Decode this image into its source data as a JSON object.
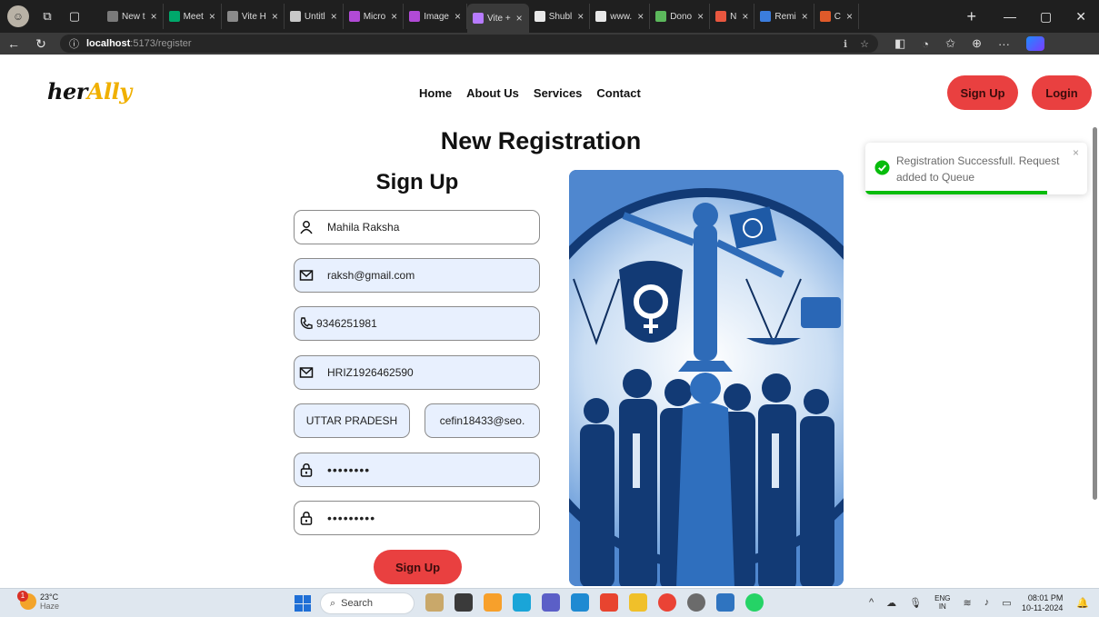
{
  "browser": {
    "tabs": [
      {
        "label": "New t",
        "color": "#7a7a7a"
      },
      {
        "label": "Meet",
        "color": "#00a86b"
      },
      {
        "label": "Vite H",
        "color": "#8a8a8a"
      },
      {
        "label": "Untitl",
        "color": "#c8c8c8"
      },
      {
        "label": "Micro",
        "color": "#b14ad6"
      },
      {
        "label": "Image",
        "color": "#b14ad6"
      },
      {
        "label": "Vite +",
        "color": "#b77bff",
        "active": true
      },
      {
        "label": "Shubl",
        "color": "#e8e8e8"
      },
      {
        "label": "www.",
        "color": "#e8e8e8"
      },
      {
        "label": "Dono",
        "color": "#5cb85c"
      },
      {
        "label": "N",
        "color": "#e9573f"
      },
      {
        "label": "Remi",
        "color": "#3b7ddd"
      },
      {
        "label": "C",
        "color": "#e05a2a"
      }
    ],
    "new_tab": "+",
    "url_host": "localhost",
    "url_path": ":5173/register"
  },
  "site": {
    "logo_part1": "her",
    "logo_part2": "Ally",
    "nav": [
      "Home",
      "About Us",
      "Services",
      "Contact"
    ],
    "signup_label": "Sign Up",
    "login_label": "Login"
  },
  "page": {
    "title": "New Registration",
    "form_title": "Sign Up",
    "fields": {
      "name": "Mahila Raksha",
      "email": "raksh@gmail.com",
      "phone": "9346251981",
      "id_number": "HRIZ1926462590",
      "state": "UTTAR PRADESH",
      "alt_email": "cefin18433@seo.",
      "password": "••••••••",
      "confirm_password": "•••••••••"
    },
    "submit_label": "Sign Up"
  },
  "toast": {
    "message": "Registration Successfull. Request added to Queue",
    "close": "×",
    "progress": 0.82
  },
  "taskbar": {
    "temp": "23°C",
    "weather": "Haze",
    "badge": "1",
    "search": "Search",
    "lang1": "ENG",
    "lang2": "IN",
    "time": "08:01 PM",
    "date": "10-11-2024"
  },
  "colors": {
    "accent": "#e94040",
    "logo_accent": "#f0b000",
    "toast_success": "#07bc0c"
  }
}
